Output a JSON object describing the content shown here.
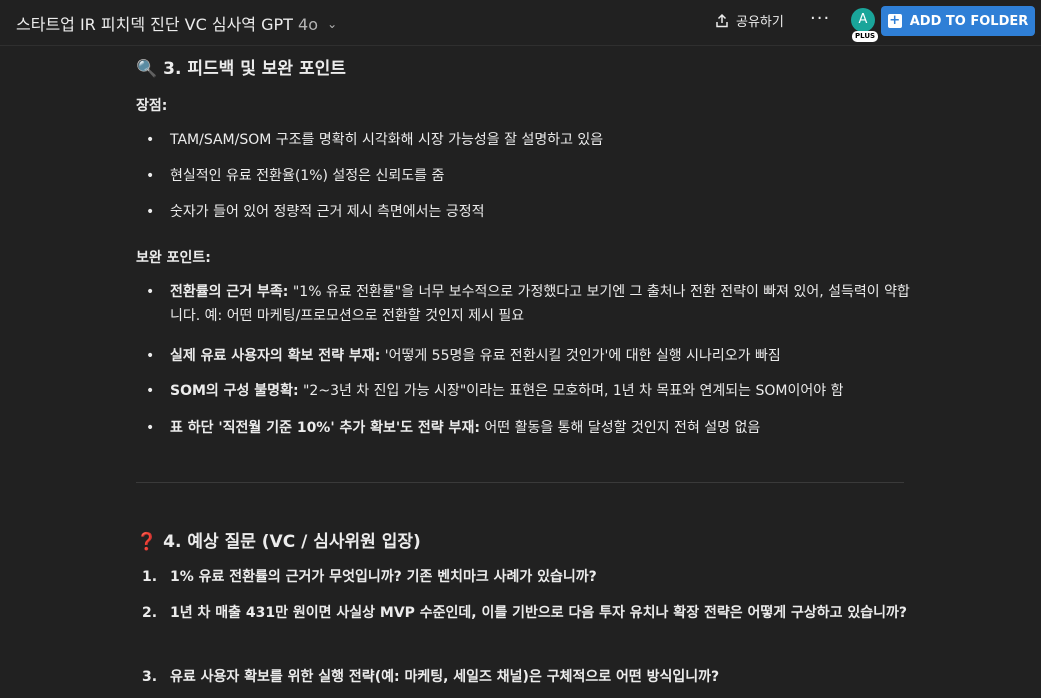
{
  "header": {
    "title": "스타트업 IR 피치덱 진단 VC 심사역 GPT",
    "model": "4o",
    "share_label": "공유하기",
    "more_label": "···",
    "avatar_letter": "A",
    "plan_badge": "PLUS",
    "folder_button_label": "ADD TO FOLDER",
    "folder_button_color": "#2f7fd6"
  },
  "section3": {
    "emoji": "🔍",
    "heading": "3. 피드백 및 보완 포인트",
    "strengths_label": "장점:",
    "strengths": [
      "TAM/SAM/SOM 구조를 명확히 시각화해 시장 가능성을 잘 설명하고 있음",
      "현실적인 유료 전환율(1%) 설정은 신뢰도를 줌",
      "숫자가 들어 있어 정량적 근거 제시 측면에서는 긍정적"
    ],
    "improve_label": "보완 포인트:",
    "improvements": [
      {
        "bold": "전환률의 근거 부족:",
        "text": " \"1% 유료 전환률\"을 너무 보수적으로 가정했다고 보기엔 그 출처나 전환 전략이 빠져 있어, 설득력이 약합니다. 예: 어떤 마케팅/프로모션으로 전환할 것인지 제시 필요"
      },
      {
        "bold": "실제 유료 사용자의 확보 전략 부재:",
        "text": " '어떻게 55명을 유료 전환시킬 것인가'에 대한 실행 시나리오가 빠짐"
      },
      {
        "bold": "SOM의 구성 불명확:",
        "text": " \"2~3년 차 진입 가능 시장\"이라는 표현은 모호하며, 1년 차 목표와 연계되는 SOM이어야 함"
      },
      {
        "bold": "표 하단 '직전월 기준 10%' 추가 확보'도 전략 부재:",
        "text": " 어떤 활동을 통해 달성할 것인지 전혀 설명 없음"
      }
    ]
  },
  "section4": {
    "emoji": "❓",
    "heading": "4. 예상 질문 (VC / 심사위원 입장)",
    "questions": [
      {
        "n": "1.",
        "text": "1% 유료 전환률의 근거가 무엇입니까? 기존 벤치마크 사례가 있습니까?"
      },
      {
        "n": "2.",
        "text": "1년 차 매출 431만 원이면 사실상 MVP 수준인데, 이를 기반으로 다음 투자 유치나 확장 전략은 어떻게 구상하고 있습니까?"
      },
      {
        "n": "3.",
        "text": "유료 사용자 확보를 위한 실행 전략(예: 마케팅, 세일즈 채널)은 구체적으로 어떤 방식입니까?"
      }
    ]
  }
}
